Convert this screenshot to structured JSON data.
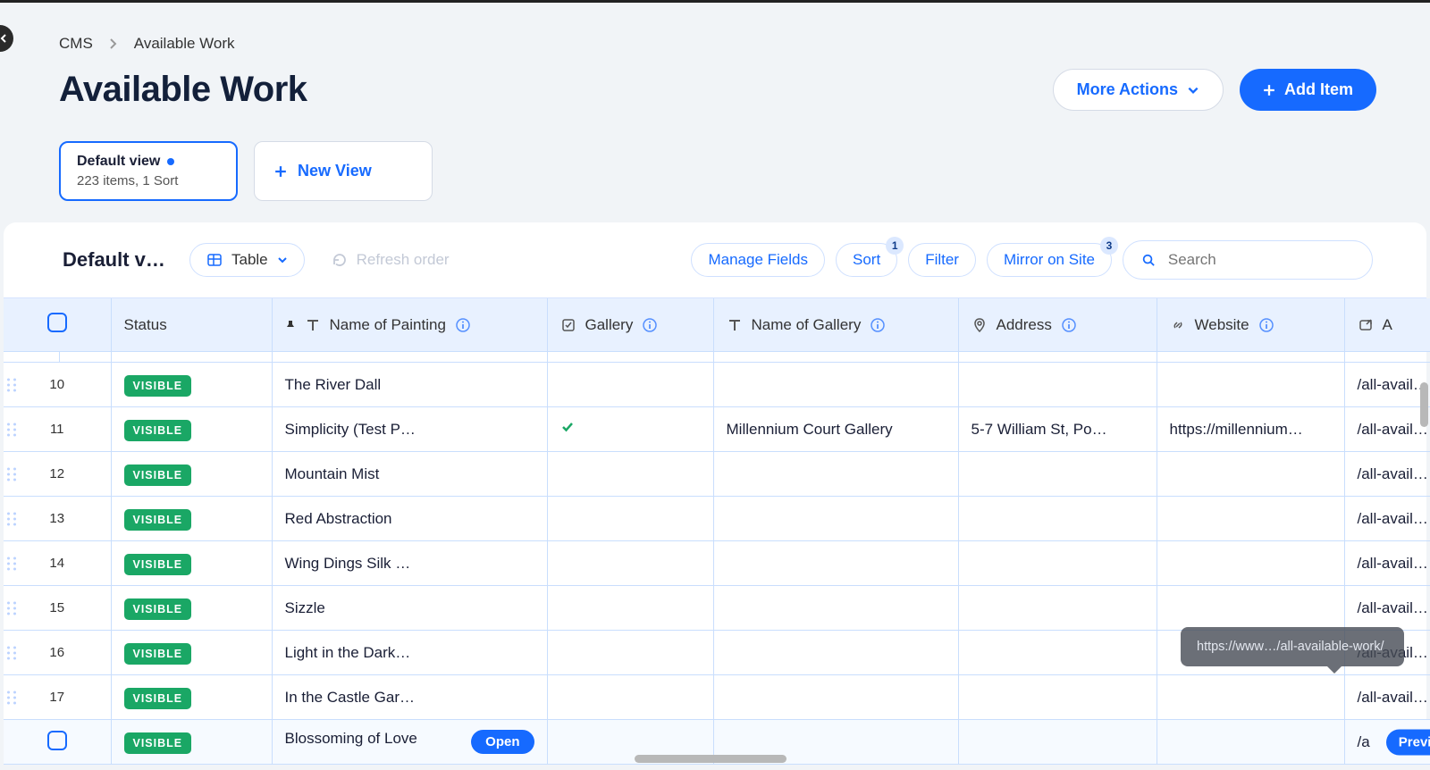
{
  "breadcrumb": {
    "root": "CMS",
    "current": "Available Work"
  },
  "page_title": "Available Work",
  "actions": {
    "more": "More Actions",
    "add": "Add Item"
  },
  "views": {
    "default": {
      "title": "Default view",
      "subtitle": "223 items, 1 Sort"
    },
    "new_view": "New View"
  },
  "toolbar": {
    "title": "Default v…",
    "table_mode": "Table",
    "refresh": "Refresh order",
    "manage_fields": "Manage Fields",
    "sort": "Sort",
    "sort_badge": "1",
    "filter": "Filter",
    "mirror": "Mirror on Site",
    "mirror_badge": "3",
    "search_placeholder": "Search"
  },
  "columns": {
    "status": "Status",
    "name": "Name of Painting",
    "gallery": "Gallery",
    "gallery_name": "Name of Gallery",
    "address": "Address",
    "website": "Website",
    "link": "A"
  },
  "rows": [
    {
      "num": "10",
      "status": "VISIBLE",
      "name": "The River Dall",
      "gallery_check": false,
      "gallery_name": "",
      "address": "",
      "website": "",
      "link": "/all-avail…"
    },
    {
      "num": "11",
      "status": "VISIBLE",
      "name": "Simplicity (Test P…",
      "gallery_check": true,
      "gallery_name": "Millennium Court Gallery",
      "address": "5-7 William St, Po…",
      "website": "https://millennium…",
      "link": "/all-avail…"
    },
    {
      "num": "12",
      "status": "VISIBLE",
      "name": "Mountain Mist",
      "gallery_check": false,
      "gallery_name": "",
      "address": "",
      "website": "",
      "link": "/all-avail…"
    },
    {
      "num": "13",
      "status": "VISIBLE",
      "name": "Red Abstraction",
      "gallery_check": false,
      "gallery_name": "",
      "address": "",
      "website": "",
      "link": "/all-avail…"
    },
    {
      "num": "14",
      "status": "VISIBLE",
      "name": "Wing Dings Silk …",
      "gallery_check": false,
      "gallery_name": "",
      "address": "",
      "website": "",
      "link": "/all-avail…"
    },
    {
      "num": "15",
      "status": "VISIBLE",
      "name": "Sizzle",
      "gallery_check": false,
      "gallery_name": "",
      "address": "",
      "website": "",
      "link": "/all-avail…"
    },
    {
      "num": "16",
      "status": "VISIBLE",
      "name": "Light in the Dark…",
      "gallery_check": false,
      "gallery_name": "",
      "address": "",
      "website": "",
      "link": "/all-avail…"
    },
    {
      "num": "17",
      "status": "VISIBLE",
      "name": "In the Castle Gar…",
      "gallery_check": false,
      "gallery_name": "",
      "address": "",
      "website": "",
      "link": "/all-avail…"
    },
    {
      "num": "",
      "status": "VISIBLE",
      "name": "Blossoming of Love",
      "gallery_check": false,
      "gallery_name": "",
      "address": "",
      "website": "",
      "link": "/a",
      "hover": true
    }
  ],
  "hover_actions": {
    "open": "Open",
    "preview": "Preview"
  },
  "tooltip": "https://www…/all-available-work/",
  "slash": "/"
}
